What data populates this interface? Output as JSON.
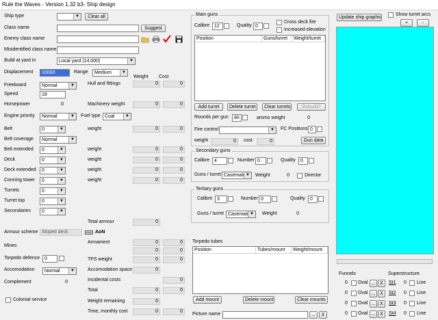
{
  "window": {
    "title": "Rule the Waves - Version 1.32 b3- Ship design"
  },
  "left": {
    "ship_type_label": "Ship type",
    "clear_all": "Clear all",
    "class_name_label": "Class name",
    "enemy_class_name_label": "Enemy class name",
    "misidentified_label": "Misidentified class name",
    "suggest": "Suggest",
    "build_at_label": "Build at yard in",
    "build_at_value": "Local yard (14.000)",
    "displacement_label": "Displacement",
    "displacement_value": "10000",
    "range_label": "Range",
    "range_value": "Medium",
    "weight_hdr": "Weight",
    "cost_hdr": "Cost",
    "freeboard_label": "Freeboard",
    "freeboard_value": "Normal",
    "hull_label": "Hull and fittings",
    "hull_weight": "0",
    "hull_cost": "0",
    "speed_label": "Speed",
    "speed_value": "18",
    "horsepower_label": "Horsepower",
    "horsepower_value": "0",
    "machinery_label": "Machinery weight",
    "machinery_weight": "0",
    "machinery_cost": "0",
    "engine_label": "Engine priority",
    "engine_value": "Normal",
    "fuel_label": "Fuel type",
    "fuel_value": "Coal",
    "belt_label": "Belt",
    "belt_value": "0",
    "belt_weight_label": "weight",
    "belt_weight": "0",
    "belt_cost": "0",
    "belt_cov_label": "Belt coverage",
    "belt_cov_value": "Normal",
    "belt_ext_label": "Belt extended",
    "belt_ext_value": "0",
    "belt_ext_weight_label": "weight",
    "belt_ext_weight": "0",
    "belt_ext_cost": "0",
    "deck_label": "Deck",
    "deck_value": "0",
    "deck_weight_label": "weight",
    "deck_weight": "0",
    "deck_cost": "0",
    "deck_ext_label": "Deck extended",
    "deck_ext_value": "0",
    "deck_ext_weight_label": "weight",
    "deck_ext_weight": "0",
    "deck_ext_cost": "0",
    "ct_label": "Conning tower",
    "ct_value": "0",
    "ct_weight_label": "weight",
    "ct_weight": "0",
    "ct_cost": "0",
    "turrets_label": "Turrets",
    "turrets_value": "0",
    "turret_top_label": "Turret top",
    "turret_top_value": "0",
    "secondaries_label": "Secondaries",
    "secondaries_value": "0",
    "total_armour_label": "Total armour",
    "total_armour_weight": "0",
    "armour_scheme_label": "Armour scheme",
    "armour_scheme_value": "Sloped deck",
    "aon_label": "AoN",
    "armament_label": "Armament",
    "armament_weight": "0",
    "armament_cost": "0",
    "mines_label": "Mines",
    "mines_weight": "0",
    "mines_cost": "0",
    "torpedo_def_label": "Torpedo defence",
    "torpedo_def_value": "0",
    "tps_label": "TPS weight",
    "tps_weight": "0",
    "tps_cost": "0",
    "accom_label": "Accomodation",
    "accom_value": "Normal",
    "accom_space_label": "Accomodation space",
    "accom_space_weight": "0",
    "complement_label": "Complement",
    "complement_value": "0",
    "incidental_label": "Incidental costs",
    "incidental_cost": "0",
    "total_label": "Total",
    "total_weight": "0",
    "total_cost": "0",
    "colonial_label": "Colonial service",
    "weight_remaining_label": "Weight remaining",
    "weight_remaining": "0",
    "time_label": "Time, monthly cost",
    "time_value": "0",
    "monthly_value": "0"
  },
  "main_guns": {
    "title": "Main guns",
    "calibre_label": "Calibre",
    "calibre_value": "12",
    "quality_label": "Quality",
    "quality_value": "0",
    "cross_deck": "Cross deck fire",
    "increased_elev": "Increased elevation",
    "col_position": "Position",
    "col_guns": "Guns/turret",
    "col_weight": "Weight/turret",
    "add_turret": "Add turret",
    "delete_turret": "Delete turret",
    "clear_turrets": "Clear turrets",
    "rebuild": "Rebuild?",
    "rounds_label": "Rounds per gun",
    "rounds_value": "80",
    "ammo_label": "ammo weight",
    "ammo_value": "0",
    "fire_control_label": "Fire control",
    "fc_positions_label": "FC Positions",
    "fc_positions_value": "0",
    "weight_label": "weight",
    "weight_value": "0",
    "cost_label": "cost",
    "cost_value": "0",
    "gun_data": "Gun data"
  },
  "secondary": {
    "title": "Secondary guns",
    "calibre_label": "Calibre",
    "calibre_value": "4",
    "number_label": "Number",
    "number_value": "0",
    "quality_label": "Quality",
    "quality_value": "0",
    "guns_turret_label": "Guns / turret",
    "guns_turret_value": "Casemate",
    "weight_label": "Weight",
    "weight_value": "0",
    "director_label": "Director"
  },
  "tertiary": {
    "title": "Tertiary guns",
    "calibre_label": "Calibre",
    "calibre_value": "3",
    "number_label": "Number",
    "number_value": "0",
    "quality_label": "Quality",
    "quality_value": "0",
    "guns_turret_label": "Guns / turret",
    "guns_turret_value": "Casemate",
    "weight_label": "Weight",
    "weight_value": "0"
  },
  "torpedo": {
    "title": "Torpedo tubes",
    "col_position": "Position",
    "col_tubes": "Tubes/mount",
    "col_weight": "Weight/mount",
    "add_mount": "Add mount",
    "delete_mount": "Delete mount",
    "clear_mounts": "Clear mounts"
  },
  "picture": {
    "label": "Picture name",
    "browse": "...",
    "clear": "X"
  },
  "right": {
    "update_graphic": "Update ship graphic",
    "show_turret_arcs": "Show turret arcs",
    "plus": "+",
    "minus": "-",
    "canvas_color": "#00ffff",
    "funnels_label": "Funnels",
    "superstructure_label": "Superstructure",
    "rows": [
      {
        "num": "0",
        "oval": "Oval",
        "st": "St1",
        "st_num": "0",
        "line": "Line"
      },
      {
        "num": "0",
        "oval": "Oval",
        "st": "St2",
        "st_num": "0",
        "line": "Line"
      },
      {
        "num": "0",
        "oval": "Oval",
        "st": "St3",
        "st_num": "0",
        "line": "Line"
      },
      {
        "num": "0",
        "oval": "Oval",
        "st": "St4",
        "st_num": "0",
        "line": "Line"
      }
    ],
    "dots": "...",
    "x": "X"
  }
}
